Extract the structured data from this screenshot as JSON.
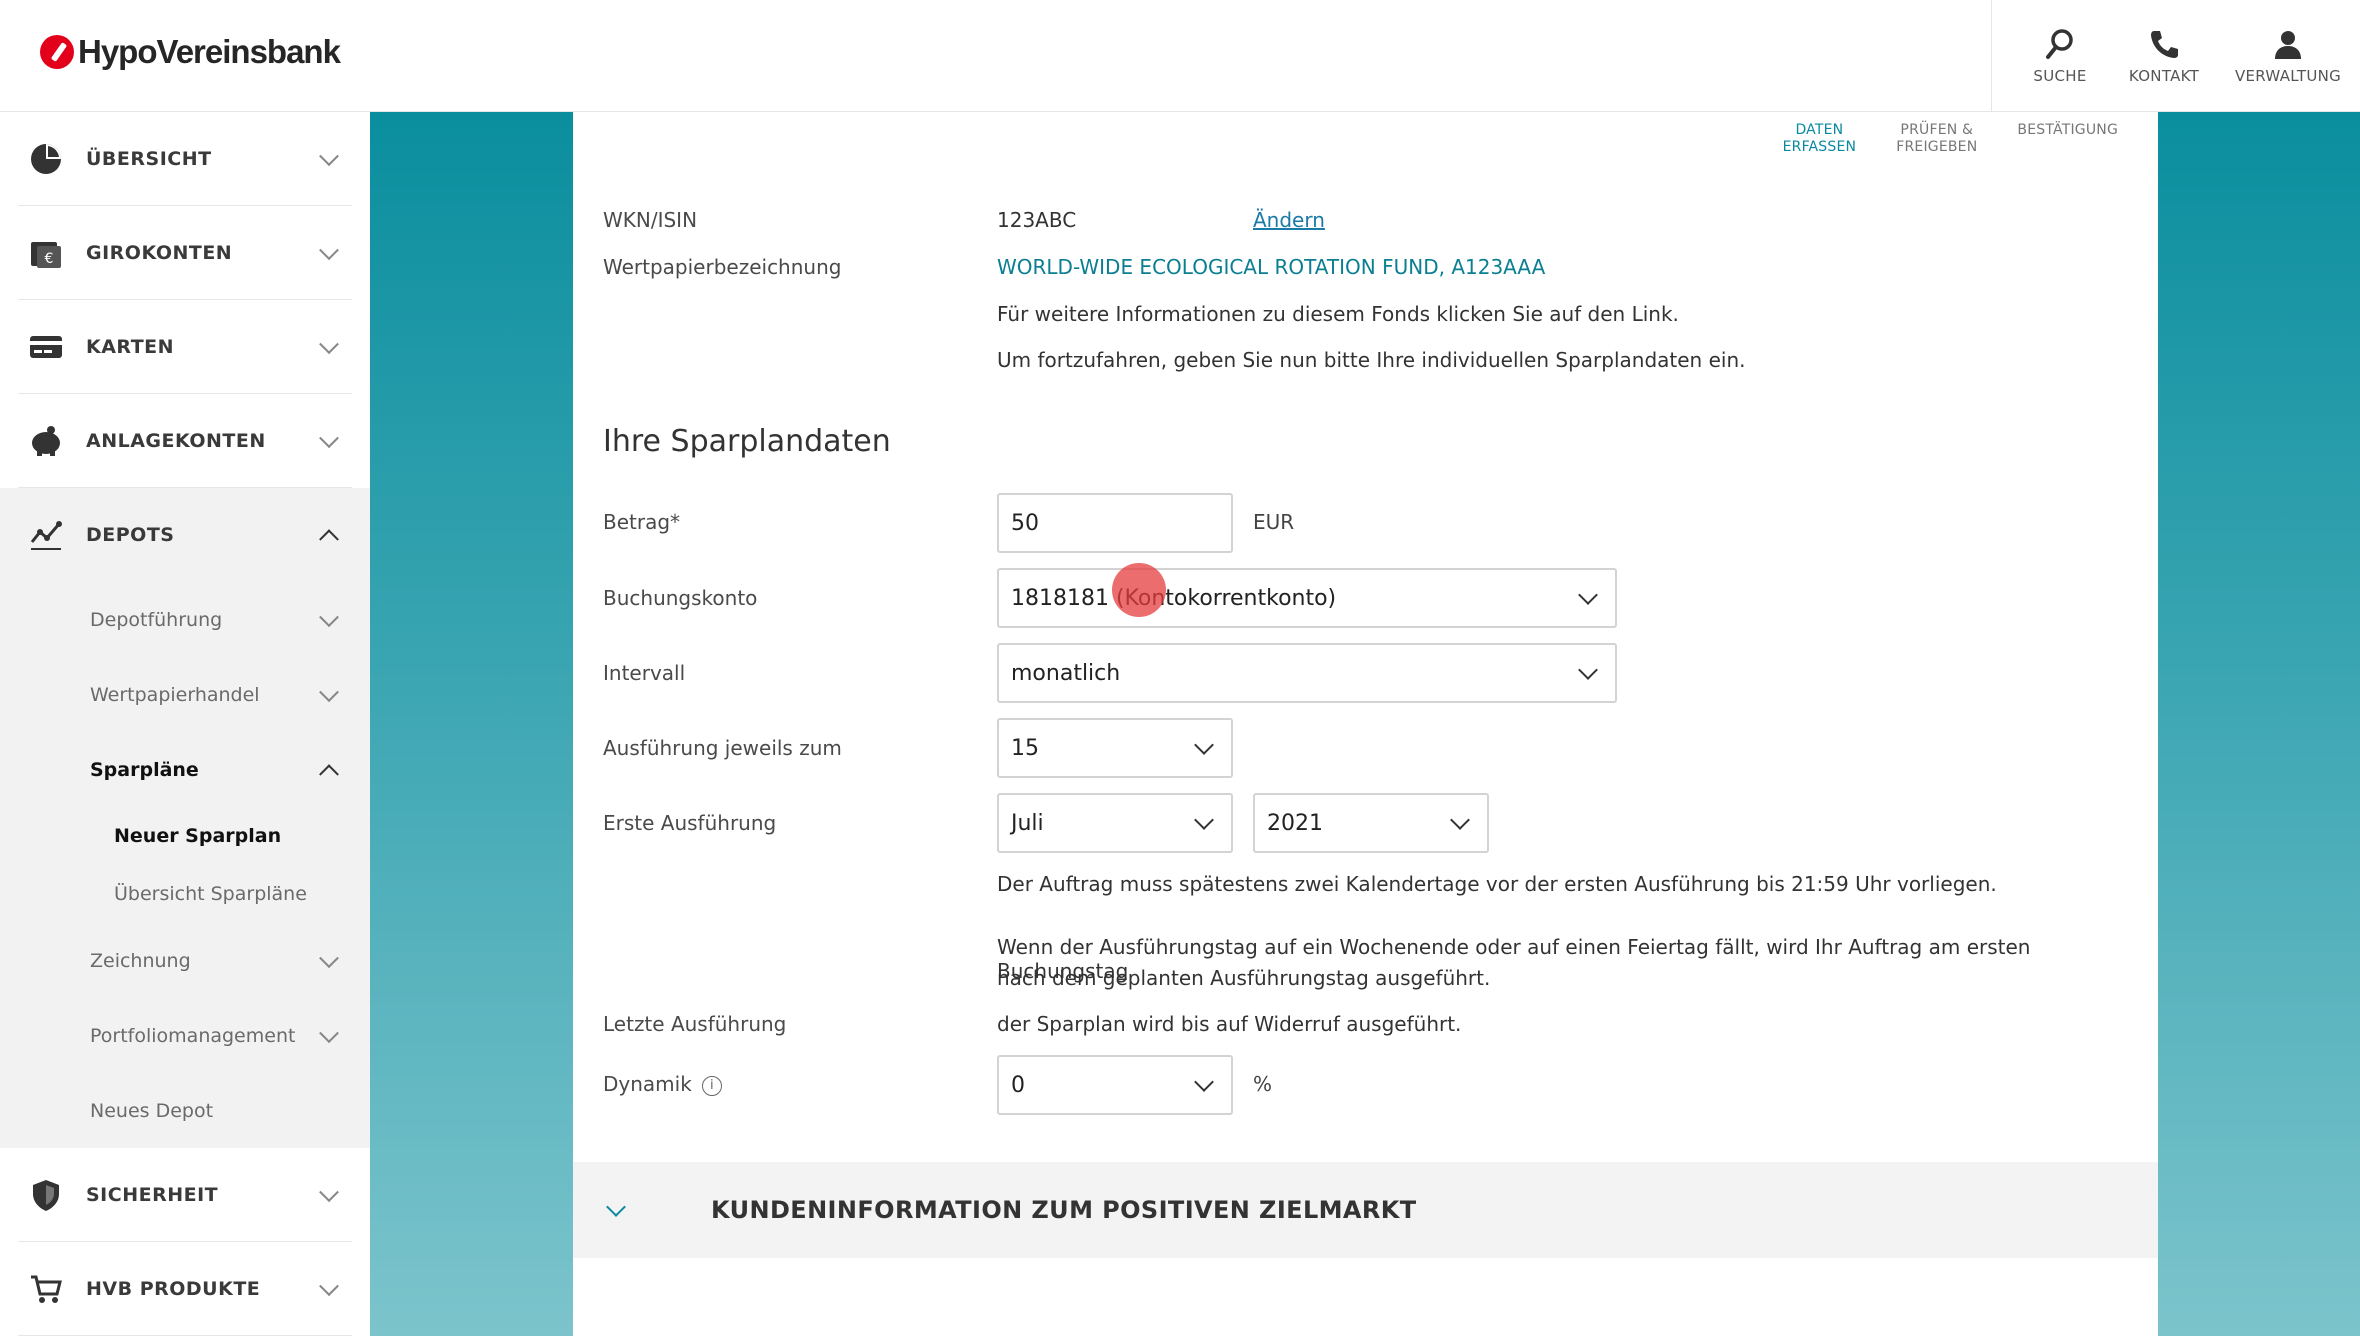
{
  "header": {
    "brand": "HypoVereinsbank",
    "actions": [
      {
        "label": "SUCHE",
        "icon": "search-icon"
      },
      {
        "label": "KONTAKT",
        "icon": "phone-icon"
      },
      {
        "label": "VERWALTUNG",
        "icon": "user-icon"
      }
    ]
  },
  "sidebar": {
    "items": [
      {
        "label": "ÜBERSICHT",
        "icon": "pie-chart-icon"
      },
      {
        "label": "GIROKONTEN",
        "icon": "wallet-icon"
      },
      {
        "label": "KARTEN",
        "icon": "card-icon"
      },
      {
        "label": "ANLAGEKONTEN",
        "icon": "piggy-bank-icon"
      },
      {
        "label": "DEPOTS",
        "icon": "chart-line-icon"
      },
      {
        "label": "SICHERHEIT",
        "icon": "shield-icon"
      },
      {
        "label": "HVB PRODUKTE",
        "icon": "cart-icon"
      }
    ],
    "depots_sub": [
      "Depotführung",
      "Wertpapierhandel",
      "Sparpläne",
      "Zeichnung",
      "Portfoliomanagement",
      "Neues Depot"
    ],
    "sparplaene_sub": [
      "Neuer Sparplan",
      "Übersicht Sparpläne"
    ]
  },
  "steps": {
    "step1": [
      "DATEN",
      "ERFASSEN"
    ],
    "step2": [
      "PRÜFEN &",
      "FREIGEBEN"
    ],
    "step3": "BESTÄTIGUNG"
  },
  "form": {
    "wkn_label": "WKN/ISIN",
    "wkn_value": "123ABC",
    "change_link": "Ändern",
    "bezeichnung_label": "Wertpapierbezeichnung",
    "bezeichnung_value": "WORLD-WIDE ECOLOGICAL ROTATION FUND, A123AAA",
    "info1": "Für weitere Informationen zu diesem Fonds klicken Sie auf den Link.",
    "info2": "Um fortzufahren, geben Sie nun bitte Ihre individuellen Sparplandaten ein.",
    "section_title": "Ihre Sparplandaten",
    "betrag_label": "Betrag*",
    "betrag_value": "50",
    "betrag_unit": "EUR",
    "konto_label": "Buchungskonto",
    "konto_value": "1818181 (Kontokorrentkonto)",
    "intervall_label": "Intervall",
    "intervall_value": "monatlich",
    "ausfuehrung_label": "Ausführung jeweils zum",
    "ausfuehrung_value": "15",
    "erste_label": "Erste Ausführung",
    "erste_month": "Juli",
    "erste_year": "2021",
    "note1": "Der Auftrag muss spätestens zwei Kalendertage vor der ersten Ausführung bis 21:59 Uhr vorliegen.",
    "note2a": "Wenn der Ausführungstag auf ein Wochenende oder auf einen Feiertag fällt, wird Ihr Auftrag am ersten Buchungstag",
    "note2b": "nach dem geplanten Ausführungstag ausgeführt.",
    "letzte_label": "Letzte Ausführung",
    "letzte_value": "der Sparplan wird bis auf Widerruf ausgeführt.",
    "dynamik_label": "Dynamik",
    "dynamik_value": "0",
    "dynamik_unit": "%"
  },
  "accordion": {
    "title": "KUNDENINFORMATION ZUM POSITIVEN ZIELMARKT"
  }
}
